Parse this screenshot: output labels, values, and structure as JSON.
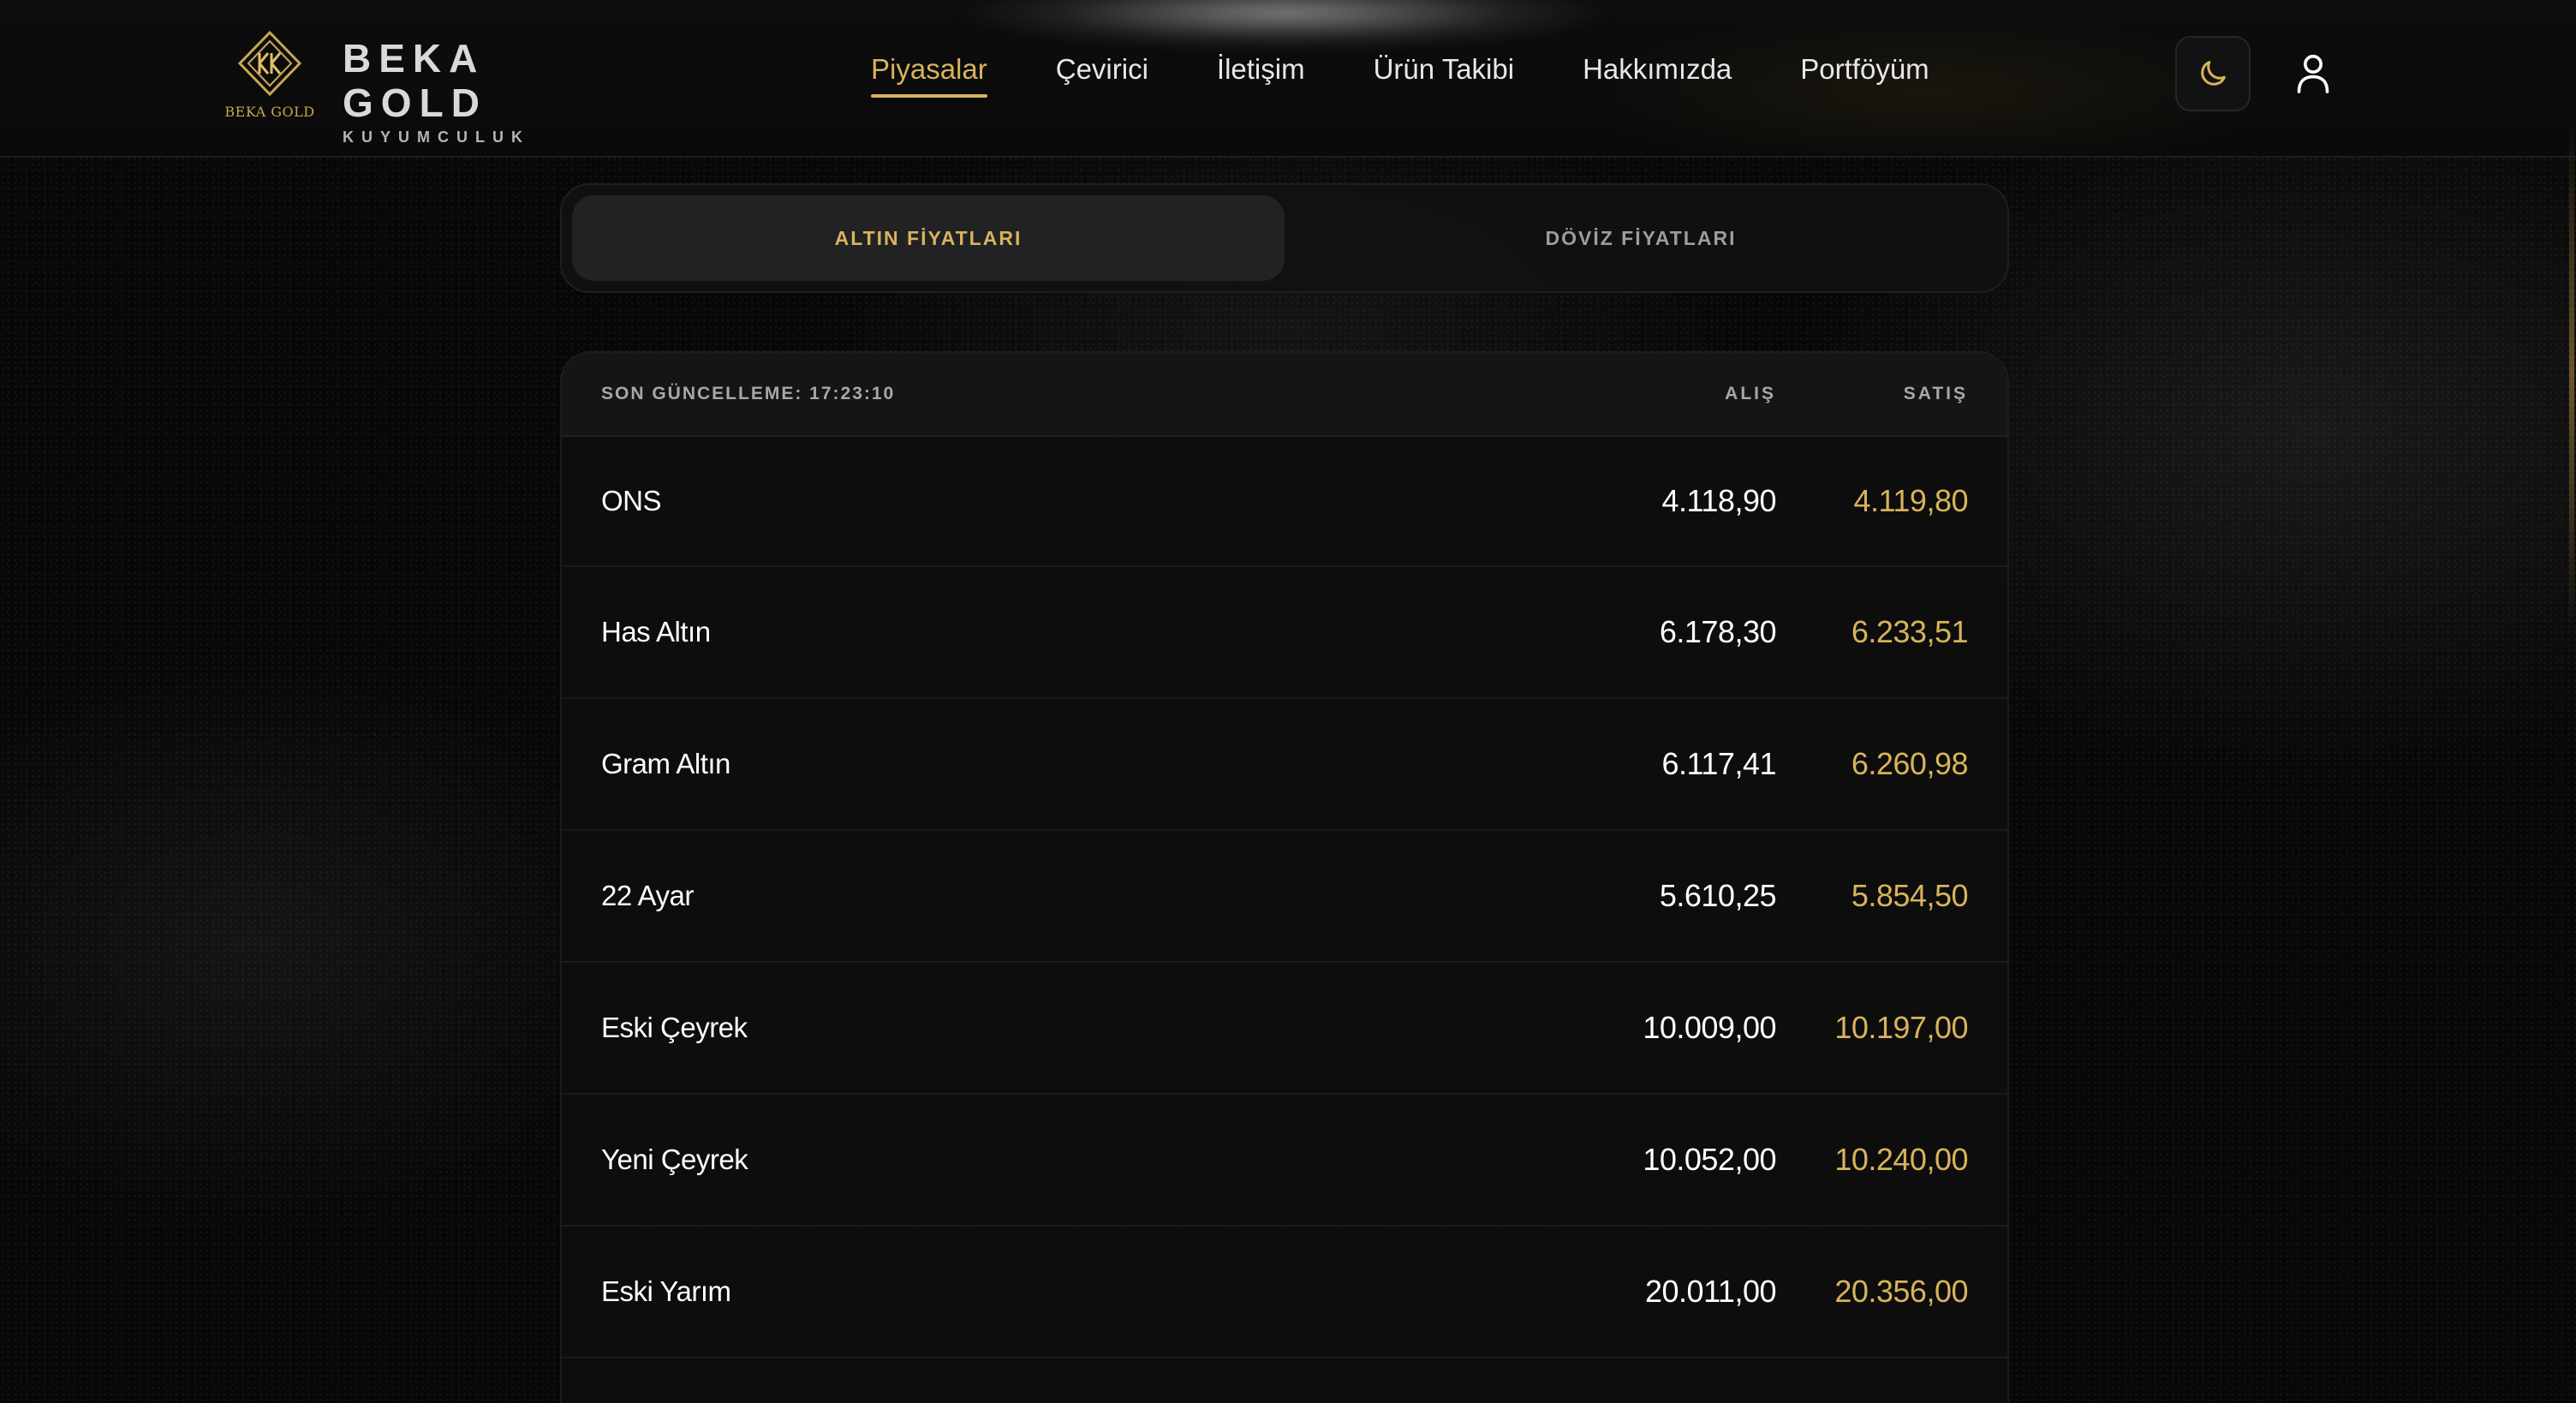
{
  "brand": {
    "name": "BEKA GOLD",
    "tagline": "KUYUMCULUK",
    "logo_text": "BEKA GOLD",
    "accent": "#d8b35a"
  },
  "nav": {
    "items": [
      {
        "label": "Piyasalar",
        "active": true
      },
      {
        "label": "Çevirici",
        "active": false
      },
      {
        "label": "İletişim",
        "active": false
      },
      {
        "label": "Ürün Takibi",
        "active": false
      },
      {
        "label": "Hakkımızda",
        "active": false
      },
      {
        "label": "Portföyüm",
        "active": false
      }
    ],
    "theme_icon": "moon-icon",
    "user_icon": "user-icon"
  },
  "tabs": [
    {
      "label": "ALTIN FİYATLARI",
      "active": true
    },
    {
      "label": "DÖVİZ FİYATLARI",
      "active": false
    }
  ],
  "table": {
    "last_update": "SON GÜNCELLEME: 17:23:10",
    "buy_header": "ALIŞ",
    "sell_header": "SATIŞ",
    "rows": [
      {
        "name": "ONS",
        "buy": "4.118,90",
        "sell": "4.119,80"
      },
      {
        "name": "Has Altın",
        "buy": "6.178,30",
        "sell": "6.233,51"
      },
      {
        "name": "Gram Altın",
        "buy": "6.117,41",
        "sell": "6.260,98"
      },
      {
        "name": "22 Ayar",
        "buy": "5.610,25",
        "sell": "5.854,50"
      },
      {
        "name": "Eski Çeyrek",
        "buy": "10.009,00",
        "sell": "10.197,00"
      },
      {
        "name": "Yeni Çeyrek",
        "buy": "10.052,00",
        "sell": "10.240,00"
      },
      {
        "name": "Eski Yarım",
        "buy": "20.011,00",
        "sell": "20.356,00"
      }
    ]
  }
}
